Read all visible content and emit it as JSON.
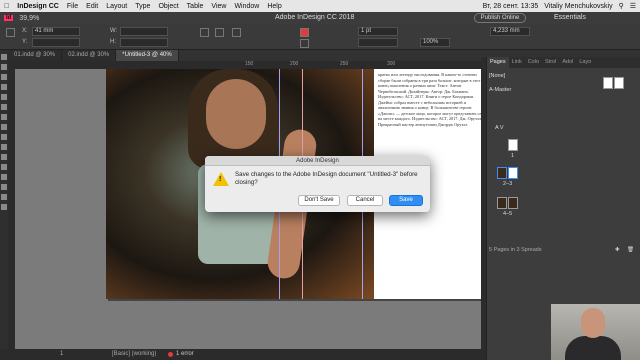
{
  "menubar": {
    "apple": "",
    "app": "InDesign CC",
    "items": [
      "File",
      "Edit",
      "Layout",
      "Type",
      "Object",
      "Table",
      "View",
      "Window",
      "Help"
    ],
    "clock": "Вт, 28 сент. 13:35",
    "user": "Vitaliy Menchukovskiy"
  },
  "appbar": {
    "logo": "Id",
    "zoom": "39,9%",
    "title": "Adobe InDesign CC 2018",
    "publish": "Publish Online",
    "workspace": "Essentials"
  },
  "control": {
    "x_label": "X:",
    "x_value": "41 mm",
    "y_label": "Y:",
    "y_value": "",
    "w_label": "W:",
    "h_label": "H:",
    "stroke": "1 pt",
    "percent": "100%",
    "size": "4,233 mm"
  },
  "tabs": [
    {
      "label": "01.indd @ 30%",
      "active": false
    },
    {
      "label": "02.indd @ 30%",
      "active": false
    },
    {
      "label": "*Untitled-3 @ 40%",
      "active": true
    }
  ],
  "ruler": {
    "ticks": [
      "150",
      "200",
      "250",
      "300"
    ]
  },
  "document_text": {
    "col": "кратко или легенду наследования. В каком-то степени сборке были собраны в три раза больше, которые в этот и конец поколения о разных книг. Текст: Антон Чернобельский. Дизайнеры: Автор: Дж. Бахмано. Издательство: АСТ, 2017. Книги о герое Кондорами. Джеймс собрал вместе с небольшим историей и аналитикою знания о конце. В большинстве героев «Джоли» — детское лицо, которое могут представить себя на месте каждого. Издательство: АСТ, 2017. Дж. Оруэлл. Прекрасный мастер антиутопии Джордж Оруэлл"
  },
  "dialog": {
    "title": "Adobe InDesign",
    "message": "Save changes to the Adobe InDesign document \"Untitled-3\" before closing?",
    "dont_save": "Don't Save",
    "cancel": "Cancel",
    "save": "Save"
  },
  "panel": {
    "tabs": [
      "Pages",
      "Link",
      "Colo",
      "Strol",
      "Adol",
      "Layo"
    ],
    "none_label": "[None]",
    "master_label": "A-Master",
    "av_label": "A V",
    "page1": "1",
    "spread1": "2–3",
    "spread2": "4–5",
    "footer": "5 Pages in 3 Spreads"
  },
  "status": {
    "page": "1",
    "mode": "[Basic] (working)",
    "errors": "1 error"
  },
  "colors": {
    "accent": "#2e8ef3",
    "indesign_pink": "#ff3366",
    "warning": "#f2c200",
    "error_red": "#e23b3b"
  }
}
